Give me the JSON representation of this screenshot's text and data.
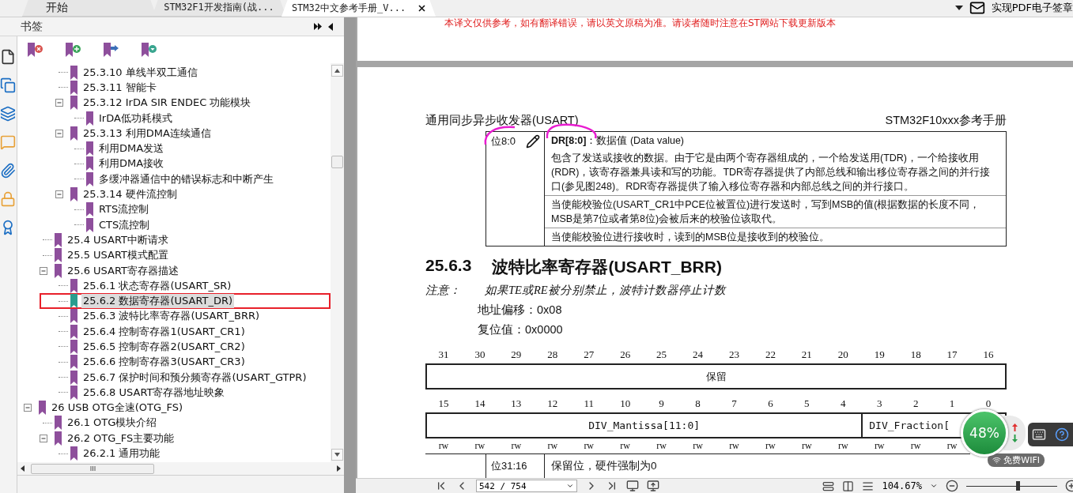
{
  "tabs": [
    {
      "label": "开始",
      "selected": false
    },
    {
      "label": "STM32F1开发指南(战...",
      "selected": false
    },
    {
      "label": "STM32中文参考手册_V...",
      "selected": true
    }
  ],
  "tab_bar_right": {
    "promo": "实现PDF电子签章"
  },
  "bookmarks": {
    "title": "书签",
    "tree": [
      {
        "children": [
          {
            "children": [
              {
                "title": "25.3.10 单线半双工通信",
                "selected": false
              },
              {
                "title": "25.3.11 智能卡",
                "selected": false
              },
              {
                "title": "25.3.12 IrDA SIR ENDEC 功能模块",
                "selected": false,
                "expanded": true,
                "children": [
                  {
                    "title": "IrDA低功耗模式",
                    "selected": false
                  }
                ]
              },
              {
                "title": "25.3.13 利用DMA连续通信",
                "selected": false,
                "expanded": true,
                "children": [
                  {
                    "title": "利用DMA发送",
                    "selected": false
                  },
                  {
                    "title": "利用DMA接收",
                    "selected": false
                  },
                  {
                    "title": "多缓冲器通信中的错误标志和中断产生",
                    "selected": false
                  }
                ]
              },
              {
                "title": "25.3.14 硬件流控制",
                "selected": false,
                "expanded": true,
                "children": [
                  {
                    "title": "RTS流控制",
                    "selected": false
                  },
                  {
                    "title": "CTS流控制",
                    "selected": false
                  }
                ]
              }
            ]
          },
          {
            "title": "25.4 USART中断请求",
            "selected": false
          },
          {
            "title": "25.5 USART模式配置",
            "selected": false
          },
          {
            "title": "25.6 USART寄存器描述",
            "selected": false,
            "expanded": true,
            "children": [
              {
                "title": "25.6.1 状态寄存器(USART_SR)",
                "selected": false
              },
              {
                "title": "25.6.2 数据寄存器(USART_DR)",
                "selected": true
              },
              {
                "title": "25.6.3 波特比率寄存器(USART_BRR)",
                "selected": false
              },
              {
                "title": "25.6.4 控制寄存器1(USART_CR1)",
                "selected": false
              },
              {
                "title": "25.6.5 控制寄存器2(USART_CR2)",
                "selected": false
              },
              {
                "title": "25.6.6 控制寄存器3(USART_CR3)",
                "selected": false
              },
              {
                "title": "25.6.7 保护时间和预分频寄存器(USART_GTPR)",
                "selected": false
              },
              {
                "title": "25.6.8 USART寄存器地址映象",
                "selected": false
              }
            ]
          }
        ]
      },
      {
        "title": "26 USB OTG全速(OTG_FS)",
        "selected": false,
        "expanded": true,
        "children": [
          {
            "title": "26.1 OTG模块介绍",
            "selected": false
          },
          {
            "title": "26.2 OTG_FS主要功能",
            "selected": false,
            "expanded": true,
            "children": [
              {
                "title": "26.2.1 通用功能",
                "selected": false
              }
            ]
          }
        ]
      }
    ]
  },
  "document": {
    "banner": "本译文仅供参考，如有翻译错误，请以英文原稿为准。请读者随时注意在ST网站下载更新版本",
    "page": {
      "header_left": "通用同步异步收发器(USART)",
      "header_right": "STM32F10xxx参考手册",
      "dr_table": {
        "bits": "位8:0",
        "paragraphs": [
          "**DR[8:0]**：数据值 (Data value)",
          "包含了发送或接收的数据。由于它是由两个寄存器组成的，一个给发送用(TDR)，一个给接收用(RDR)，该寄存器兼具读和写的功能。TDR寄存器提供了内部总线和输出移位寄存器之间的并行接口(参见图248)。RDR寄存器提供了输入移位寄存器和内部总线之间的并行接口。",
          "当使能校验位(USART_CR1中PCE位被置位)进行发送时，写到MSB的值(根据数据的长度不同，MSB是第7位或者第8位)会被后来的校验位该取代。",
          "当使能校验位进行接收时，读到的MSB位是接收到的校验位。"
        ]
      },
      "section_number": "25.6.3",
      "section_title": "波特比率寄存器(USART_BRR)",
      "note_label": "注意：",
      "note": "如果TE或RE被分别禁止，波特计数器停止计数",
      "address_offset": "地址偏移：0x08",
      "reset_value": "复位值：0x0000",
      "register_rows": [
        {
          "fields": [
            {
              "name": "保留",
              "bits": [
                "31",
                "30",
                "29",
                "28",
                "27",
                "26",
                "25",
                "24",
                "23",
                "22",
                "21",
                "20",
                "19",
                "18",
                "17",
                "16"
              ]
            }
          ]
        },
        {
          "fields": [
            {
              "name": "DIV_Mantissa[11:0]",
              "bits": [
                "15",
                "14",
                "13",
                "12",
                "11",
                "10",
                "9",
                "8",
                "7",
                "6",
                "5",
                "4"
              ]
            },
            {
              "name": "DIV_Fraction[",
              "bits": [
                "3",
                "2",
                "1",
                "0"
              ]
            }
          ],
          "access": [
            "rw",
            "rw",
            "rw",
            "rw",
            "rw",
            "rw",
            "rw",
            "rw",
            "rw",
            "rw",
            "rw",
            "rw",
            "rw",
            "rw",
            "rw"
          ]
        }
      ],
      "bit_table": [
        {
          "bits": "位31:16",
          "description": "保留位，硬件强制为0"
        }
      ]
    }
  },
  "status_bar": {
    "page_field": "542 / 754",
    "zoom": "104.67%",
    "zoom_slider": {
      "level": 0.55
    }
  },
  "overlay_widget": {
    "percent": "48%",
    "wifi": "免费WIFI"
  }
}
